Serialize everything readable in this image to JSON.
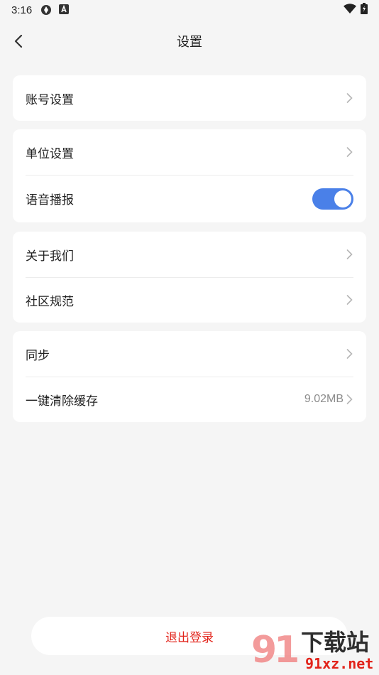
{
  "status_bar": {
    "time": "3:16"
  },
  "nav": {
    "title": "设置"
  },
  "groups": [
    {
      "items": [
        {
          "label": "账号设置"
        }
      ]
    },
    {
      "items": [
        {
          "label": "单位设置"
        },
        {
          "label": "语音播报",
          "toggle_on": true
        }
      ]
    },
    {
      "items": [
        {
          "label": "关于我们"
        },
        {
          "label": "社区规范"
        }
      ]
    },
    {
      "items": [
        {
          "label": "同步"
        },
        {
          "label": "一键清除缓存",
          "value": "9.02MB"
        }
      ]
    }
  ],
  "logout": {
    "label": "退出登录"
  },
  "watermark": {
    "number": "91",
    "text": "下载站",
    "url": "91xz.net"
  },
  "colors": {
    "accent": "#4a80e8",
    "danger": "#e2231a",
    "background": "#f5f5f5"
  }
}
